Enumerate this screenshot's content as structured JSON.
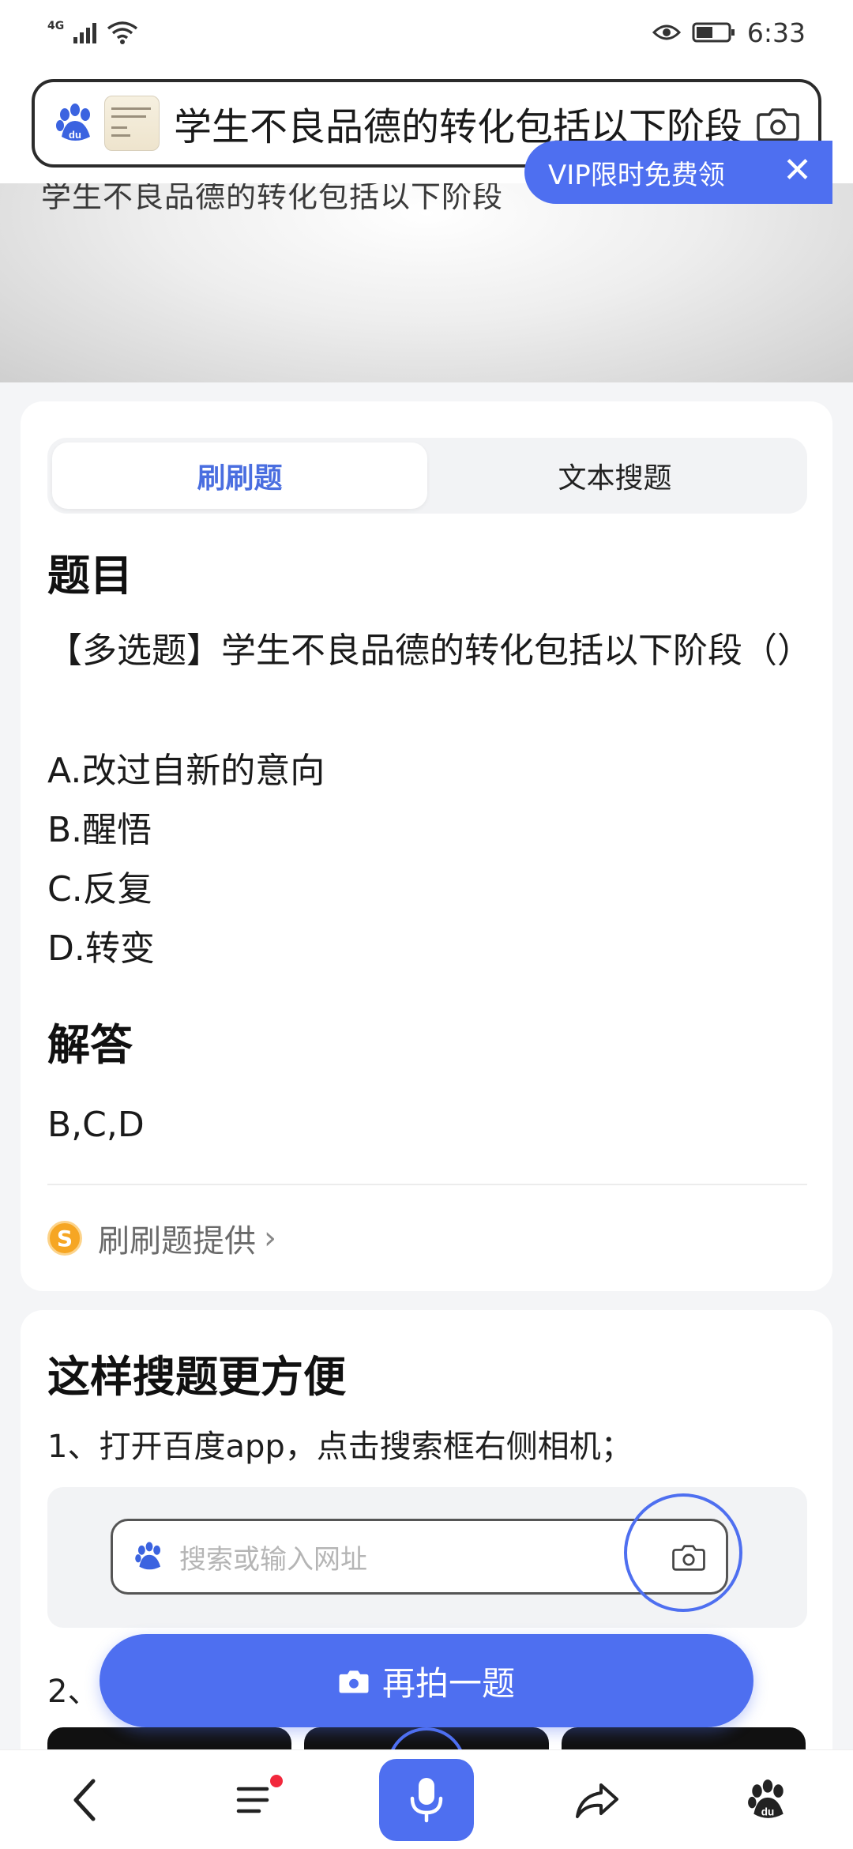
{
  "status_bar": {
    "network": "4G",
    "time": "6:33"
  },
  "search": {
    "query": "学生不良品德的转化包括以下阶段"
  },
  "photo": {
    "caption": "学生不良品德的转化包括以下阶段"
  },
  "tabs": [
    {
      "label": "刷刷题",
      "active": true
    },
    {
      "label": "文本搜题",
      "active": false
    }
  ],
  "question_section": {
    "title": "题目",
    "vip_label": "VIP限时免费领",
    "question_text": "【多选题】学生不良品德的转化包括以下阶段（）",
    "options": [
      "A.改过自新的意向",
      "B.醒悟",
      "C.反复",
      "D.转变"
    ]
  },
  "answer_section": {
    "title": "解答",
    "answer": "B,C,D"
  },
  "provider": {
    "label": "刷刷题提供",
    "badge": "S"
  },
  "tips": {
    "title": "这样搜题更方便",
    "step1": "1、打开百度app，点击搜索框右侧相机；",
    "search_placeholder": "搜索或输入网址",
    "step2_prefix": "2、"
  },
  "retake_button": {
    "label": "再拍一题"
  },
  "colors": {
    "accent": "#4e6ff0",
    "badge_dot": "#f2283c",
    "provider_coin": "#f6a623"
  },
  "bottom_nav": {
    "items": [
      "back-icon",
      "menu-icon",
      "mic-icon",
      "share-icon",
      "baidu-paw-icon"
    ]
  }
}
